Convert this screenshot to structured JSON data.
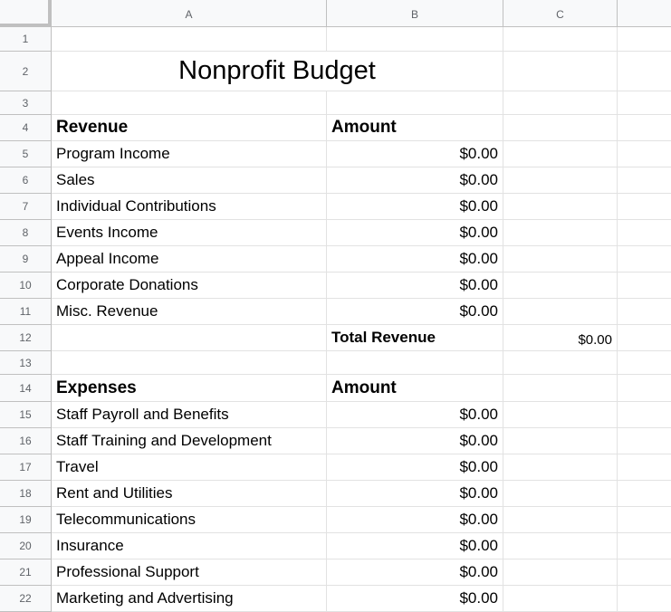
{
  "columns": [
    "A",
    "B",
    "C",
    ""
  ],
  "rows": [
    "1",
    "2",
    "3",
    "4",
    "5",
    "6",
    "7",
    "8",
    "9",
    "10",
    "11",
    "12",
    "13",
    "14",
    "15",
    "16",
    "17",
    "18",
    "19",
    "20",
    "21",
    "22"
  ],
  "title": "Nonprofit Budget",
  "revenue": {
    "header": "Revenue",
    "amount_header": "Amount",
    "items": [
      {
        "label": "Program Income",
        "amount": "$0.00"
      },
      {
        "label": "Sales",
        "amount": "$0.00"
      },
      {
        "label": "Individual Contributions",
        "amount": "$0.00"
      },
      {
        "label": "Events Income",
        "amount": "$0.00"
      },
      {
        "label": "Appeal Income",
        "amount": "$0.00"
      },
      {
        "label": "Corporate Donations",
        "amount": "$0.00"
      },
      {
        "label": "Misc. Revenue",
        "amount": "$0.00"
      }
    ],
    "total_label": "Total Revenue",
    "total_value": "$0.00"
  },
  "expenses": {
    "header": "Expenses",
    "amount_header": "Amount",
    "items": [
      {
        "label": "Staff Payroll and Benefits",
        "amount": "$0.00"
      },
      {
        "label": "Staff Training and Development",
        "amount": "$0.00"
      },
      {
        "label": "Travel",
        "amount": "$0.00"
      },
      {
        "label": "Rent and Utilities",
        "amount": "$0.00"
      },
      {
        "label": "Telecommunications",
        "amount": "$0.00"
      },
      {
        "label": "Insurance",
        "amount": "$0.00"
      },
      {
        "label": "Professional Support",
        "amount": "$0.00"
      },
      {
        "label": "Marketing and Advertising",
        "amount": "$0.00"
      }
    ]
  }
}
